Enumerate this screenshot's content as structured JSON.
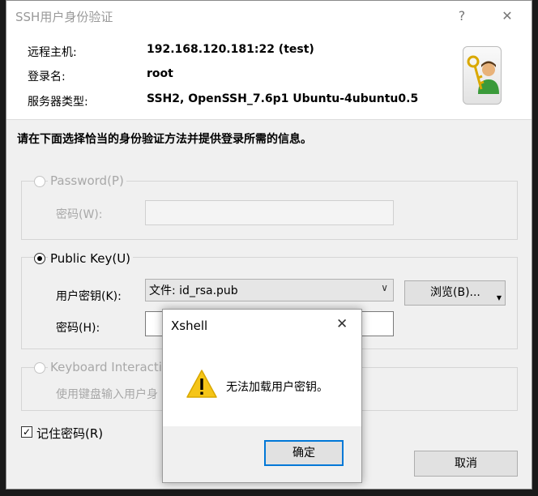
{
  "window": {
    "title": "SSH用户身份验证",
    "help_label": "?",
    "close_label": "✕"
  },
  "info": {
    "host_label": "远程主机:",
    "host_value": "192.168.120.181:22 (test)",
    "login_label": "登录名:",
    "login_value": "root",
    "server_label": "服务器类型:",
    "server_value": "SSH2, OpenSSH_7.6p1 Ubuntu-4ubuntu0.5"
  },
  "instruction": "请在下面选择恰当的身份验证方法并提供登录所需的信息。",
  "password_group": {
    "title": "Password(P)",
    "pw_label": "密码(W):"
  },
  "pubkey_group": {
    "title": "Public Key(U)",
    "userkey_label": "用户密钥(K):",
    "userkey_value": "文件: id_rsa.pub",
    "browse_label": "浏览(B)...",
    "pass_label": "密码(H):"
  },
  "keyboard_group": {
    "title": "Keyboard Interactiv",
    "desc": "使用键盘输入用户身"
  },
  "remember": {
    "label": "记住密码(R)",
    "checked": true
  },
  "cancel_label": "取消",
  "msgbox": {
    "title": "Xshell",
    "close_label": "✕",
    "message": "无法加载用户密钥。",
    "ok_label": "确定",
    "warning_color": "#f5c518"
  }
}
